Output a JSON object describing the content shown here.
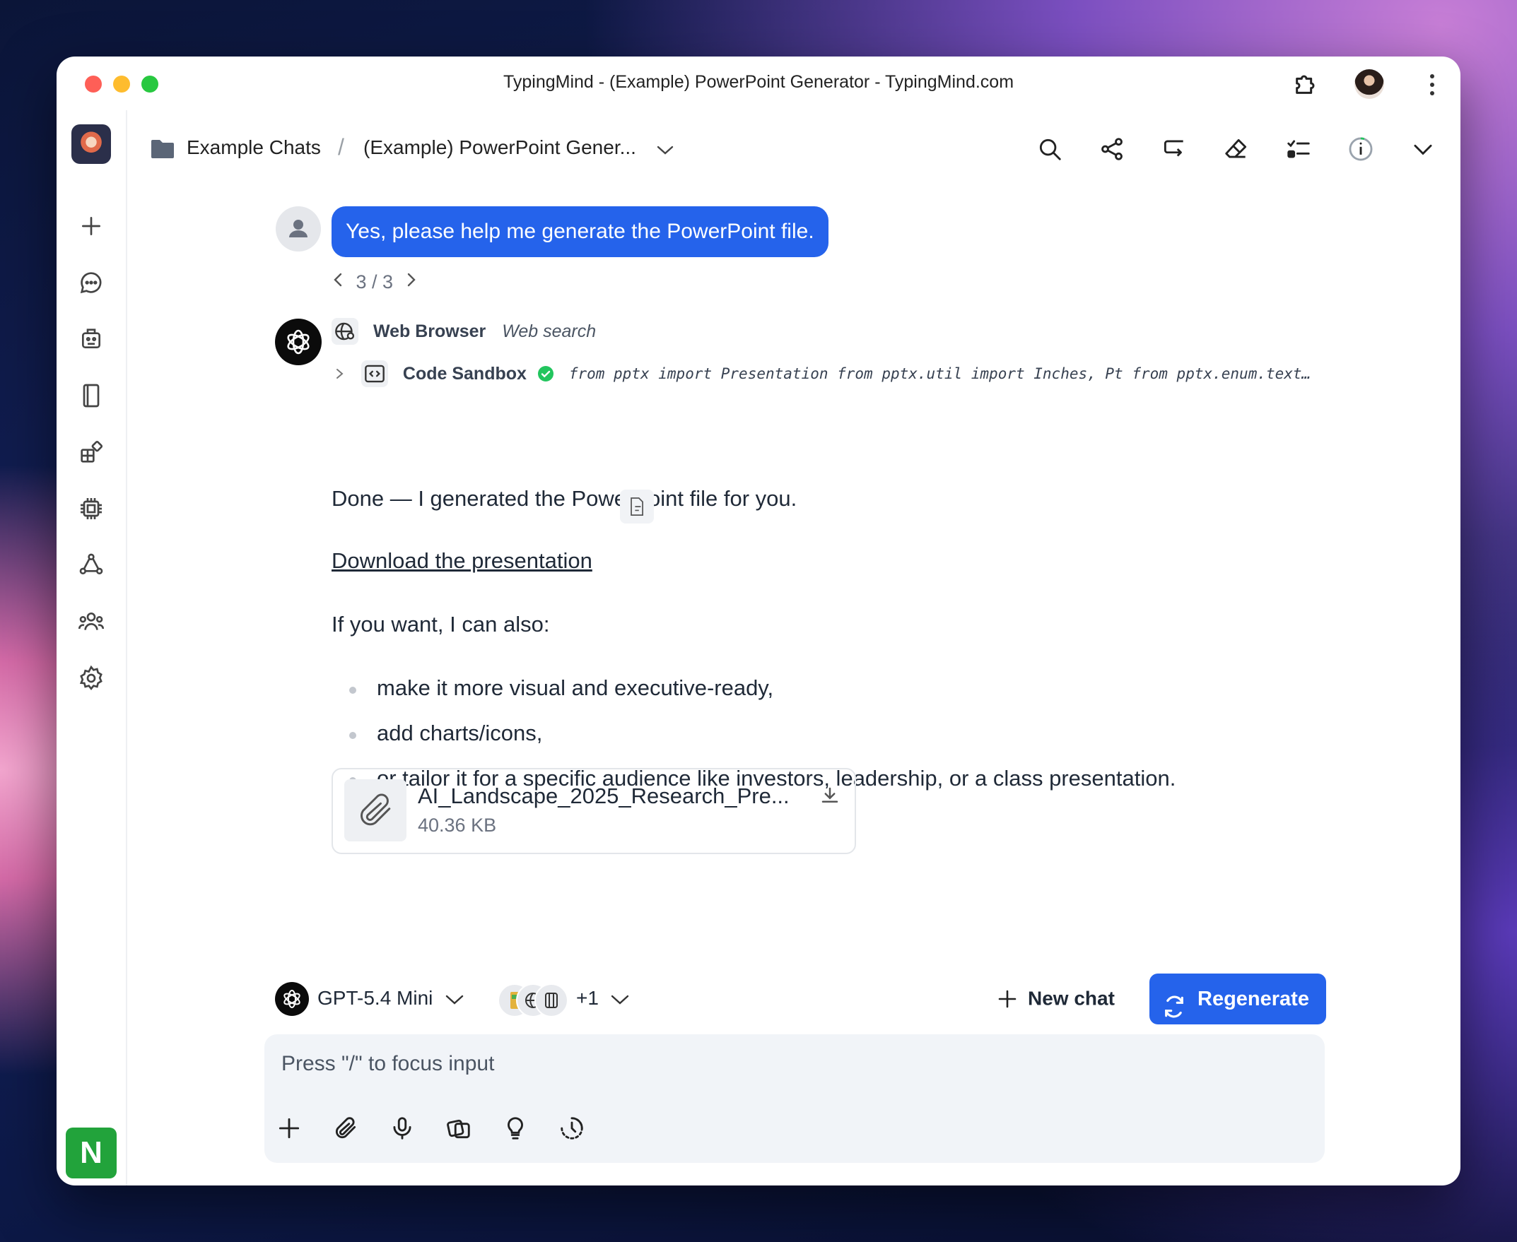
{
  "window": {
    "title": "TypingMind - (Example) PowerPoint Generator - TypingMind.com"
  },
  "breadcrumb": {
    "folder": "Example Chats",
    "separator": "/",
    "chat": "(Example) PowerPoint Gener..."
  },
  "sidebar": {
    "items": [
      "plus-icon",
      "chat-icon",
      "agents-icon",
      "prompt-library-icon",
      "plugins-icon",
      "models-icon",
      "knowledge-graph-icon",
      "team-icon",
      "settings-icon"
    ],
    "workspace_badge": "N",
    "workspace_color": "#22a33b"
  },
  "header_icons": [
    "search-icon",
    "share-icon",
    "reply-icon",
    "eraser-icon",
    "checklist-icon",
    "info-icon",
    "chevron-down-icon"
  ],
  "user_message": {
    "text": "Yes, please help me generate the PowerPoint file.",
    "pager": "3 / 3"
  },
  "assistant": {
    "tool_1": {
      "name": "Web Browser",
      "desc": "Web search"
    },
    "tool_2": {
      "name": "Code Sandbox",
      "code": "from pptx import Presentation from pptx.util import Inches, Pt from pptx.enum.text…"
    },
    "intro": "Done — I generated the PowerPoint file for you.",
    "link": "Download the presentation",
    "followup": "If you want, I can also:",
    "bullets": [
      "make it more visual and executive-ready,",
      "add charts/icons,",
      "or tailor it for a specific audience like investors, leadership, or a class presentation."
    ],
    "file": {
      "name": "AI_Landscape_2025_Research_Pre...",
      "size": "40.36 KB"
    }
  },
  "composer": {
    "model": "GPT-5.4 Mini",
    "plugins_extra": "+1",
    "new_chat": "New chat",
    "regenerate": "Regenerate",
    "placeholder": "Press \"/\" to focus input"
  },
  "colors": {
    "accent": "#2563eb",
    "success": "#22c55e"
  }
}
